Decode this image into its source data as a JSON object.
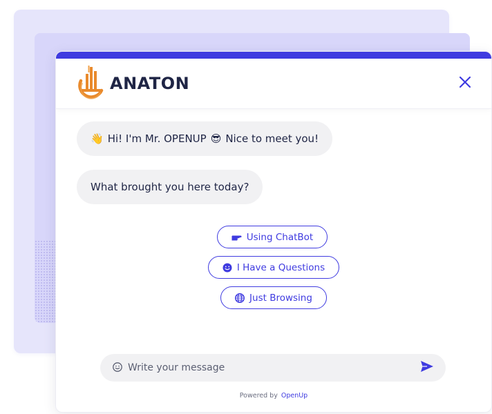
{
  "colors": {
    "accent": "#3f3be0",
    "bubble_bg": "#f1f1f3",
    "text_dark": "#1f2545",
    "logo_orange": "#e98a2c"
  },
  "header": {
    "logo_icon": "anaton-logo-icon",
    "brand_name": "ANATON",
    "close_icon": "close-icon"
  },
  "messages": [
    {
      "emoji_before": "👋",
      "text_before": "Hi! I'm Mr. OPENUP",
      "emoji_mid": "😎",
      "text_after": "Nice to meet you!"
    },
    {
      "text": "What brought you here today?"
    }
  ],
  "choices": [
    {
      "icon": "pointing-hand-icon",
      "label": "Using ChatBot"
    },
    {
      "icon": "smiley-icon",
      "label": "I Have a Questions"
    },
    {
      "icon": "globe-icon",
      "label": "Just Browsing"
    }
  ],
  "composer": {
    "emoji_icon": "smiley-icon",
    "placeholder": "Write your message",
    "send_icon": "send-icon"
  },
  "footer": {
    "powered_by": "Powered by",
    "brand": "OpenUp"
  }
}
